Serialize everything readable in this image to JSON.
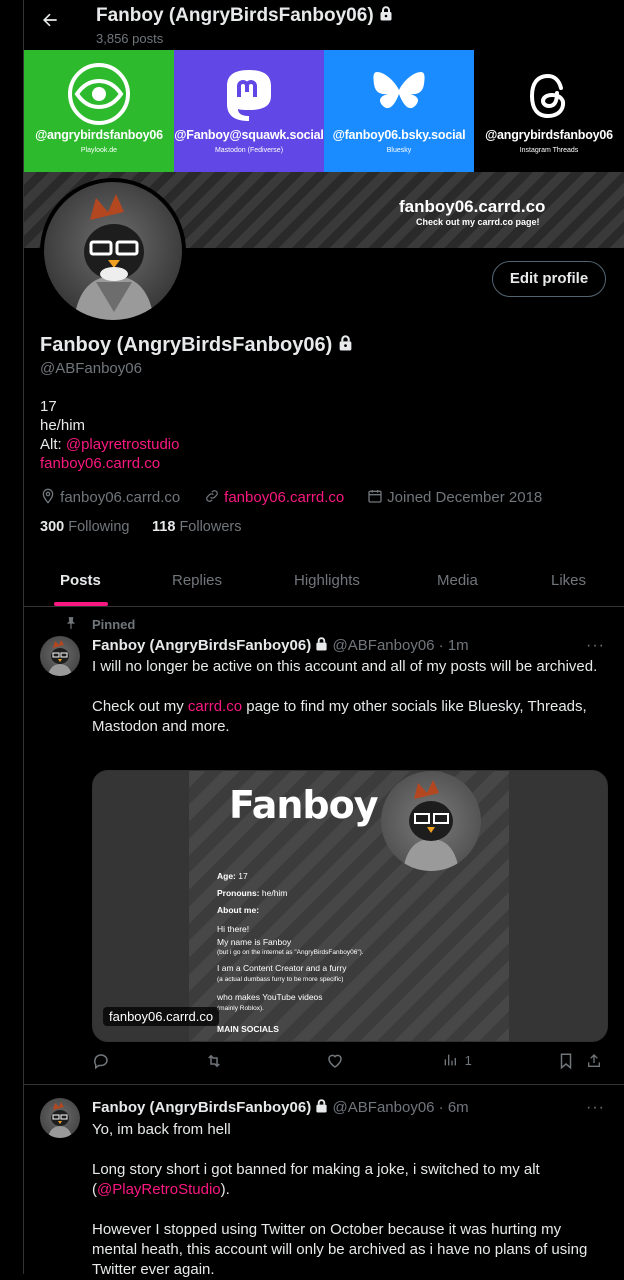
{
  "header": {
    "title": "Fanboy (AngryBirdsFanboy06)",
    "post_count": "3,856 posts"
  },
  "banner": {
    "tiles": [
      {
        "handle": "@angrybirdsfanboy06",
        "caption": "Playlook.de",
        "color": "#2dbb2d",
        "icon": "eye-icon"
      },
      {
        "handle": "@Fanboy@squawk.social",
        "caption": "Mastodon (Fediverse)",
        "color": "#6148e6",
        "icon": "mastodon-icon"
      },
      {
        "handle": "@fanboy06.bsky.social",
        "caption": "Bluesky",
        "color": "#1a8cff",
        "icon": "butterfly-icon"
      },
      {
        "handle": "@angrybirdsfanboy06",
        "caption": "Instagram Threads",
        "color": "#000000",
        "icon": "threads-icon"
      }
    ],
    "carrd_url": "fanboy06.carrd.co",
    "carrd_caption": "Check out my carrd.co page!"
  },
  "profile": {
    "edit_button": "Edit profile",
    "name": "Fanboy (AngryBirdsFanboy06)",
    "handle": "@ABFanboy06",
    "bio": {
      "line1": "17",
      "line2": "he/him",
      "alt_prefix": "Alt: ",
      "alt_link": "@playretrostudio",
      "site_link": "fanboy06.carrd.co"
    },
    "location": "fanboy06.carrd.co",
    "website": "fanboy06.carrd.co",
    "joined": "Joined December 2018",
    "following_count": "300",
    "following_label": "Following",
    "followers_count": "118",
    "followers_label": "Followers"
  },
  "tabs": [
    "Posts",
    "Replies",
    "Highlights",
    "Media",
    "Likes"
  ],
  "posts": [
    {
      "pinned_label": "Pinned",
      "author": "Fanboy (AngryBirdsFanboy06)",
      "handle": "@ABFanboy06",
      "time": "1m",
      "text1": "I will no longer be active on this account and all of my posts will be archived.",
      "text2_prefix": "Check out my ",
      "text2_link": "carrd.co",
      "text2_suffix": " page to find my other socials like Bluesky, Threads, Mastodon and more.",
      "card": {
        "title": "Fanboy",
        "age_label": "Age:",
        "age": "17",
        "pronouns_label": "Pronouns:",
        "pronouns": "he/him",
        "about_label": "About me:",
        "hi": "Hi there!",
        "name_line": "My name is Fanboy",
        "name_note": "(but i go on the internet as \"AngryBirdsFanboy06\").",
        "creator": "I am a Content Creator and a furry",
        "creator_note": "(a actual dumbass furry to be more specific)",
        "youtube": "who makes YouTube videos",
        "youtube_note": "(mainly Roblox).",
        "socials": "MAIN SOCIALS",
        "domain": "fanboy06.carrd.co"
      },
      "views": "1"
    },
    {
      "author": "Fanboy (AngryBirdsFanboy06)",
      "handle": "@ABFanboy06",
      "time": "6m",
      "text1": "Yo, im back from hell",
      "text2_prefix": "Long story short i got banned for making a joke, i switched to my alt (",
      "text2_link": "@PlayRetroStudio",
      "text2_suffix": ").",
      "text3": "However I stopped using Twitter on October because it was hurting my mental heath, this account will only be archived as i have no plans of using Twitter ever again."
    }
  ],
  "colors": {
    "accent": "#f91880",
    "muted": "#71767b",
    "border": "#2f3336"
  }
}
